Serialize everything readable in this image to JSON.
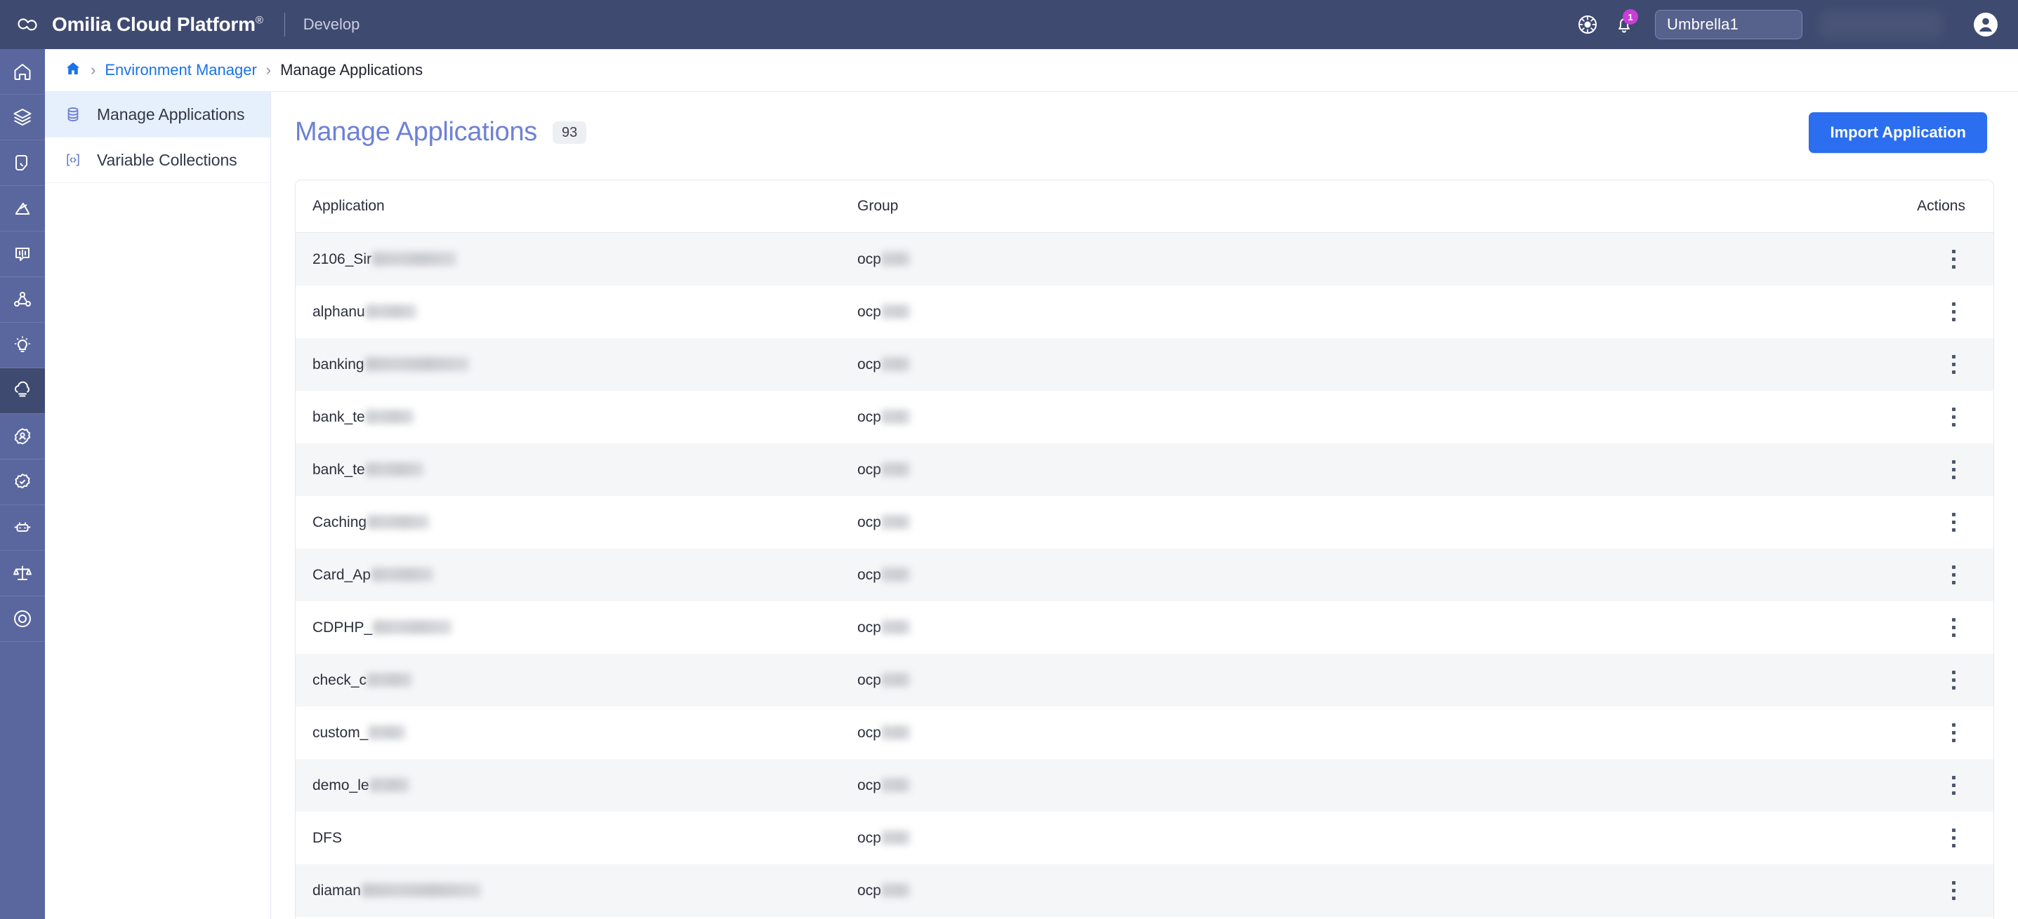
{
  "topbar": {
    "brand_name": "Omilia Cloud Platform",
    "brand_trademark": "®",
    "environment_label": "Develop",
    "logo_icon": "omilia-cloud-logo",
    "theme_icon": "theme-wheel-icon",
    "notifications_icon": "bell-icon",
    "notifications_count": "1",
    "tenant_name": "Umbrella1",
    "avatar_icon": "user-avatar-icon",
    "accent_color": "#2b6ef0",
    "bar_color": "#3f4a70",
    "badge_color": "#c83ed6"
  },
  "rail": {
    "items": [
      {
        "name": "home",
        "icon": "home-icon",
        "active": false
      },
      {
        "name": "applications",
        "icon": "layers-icon",
        "active": false
      },
      {
        "name": "tagging",
        "icon": "tag-hand-icon",
        "active": false
      },
      {
        "name": "analytics",
        "icon": "analytics-icon",
        "active": false
      },
      {
        "name": "conversations",
        "icon": "speech-waveform-icon",
        "active": false
      },
      {
        "name": "flows",
        "icon": "network-nodes-icon",
        "active": false
      },
      {
        "name": "insights",
        "icon": "lightbulb-icon",
        "active": false
      },
      {
        "name": "environment-manager",
        "icon": "cloud-icon",
        "active": true
      },
      {
        "name": "user-management",
        "icon": "gear-user-icon",
        "active": false
      },
      {
        "name": "quality-assurance",
        "icon": "badge-check-icon",
        "active": false
      },
      {
        "name": "automation",
        "icon": "robot-icon",
        "active": false
      },
      {
        "name": "compliance",
        "icon": "scales-icon",
        "active": false
      },
      {
        "name": "support",
        "icon": "lifebuoy-icon",
        "active": false
      }
    ]
  },
  "breadcrumb": {
    "home_icon": "home-icon",
    "separator": "›",
    "items": [
      {
        "label": "Environment Manager",
        "current": false
      },
      {
        "label": "Manage Applications",
        "current": true
      }
    ]
  },
  "sidebar": {
    "items": [
      {
        "label": "Manage Applications",
        "icon": "database-icon",
        "active": true
      },
      {
        "label": "Variable Collections",
        "icon": "code-brackets-icon",
        "active": false
      }
    ]
  },
  "page": {
    "title": "Manage Applications",
    "count": "93",
    "import_button": "Import Application"
  },
  "table": {
    "columns": [
      "Application",
      "Group",
      "Actions"
    ],
    "row_action_icon": "more-vertical-icon",
    "rows": [
      {
        "application": "2106_Sir",
        "application_redacted_width": 120,
        "group": "ocp",
        "group_redacted_width": 40
      },
      {
        "application": "alphanu",
        "application_redacted_width": 72,
        "group": "ocp",
        "group_redacted_width": 40
      },
      {
        "application": "banking",
        "application_redacted_width": 148,
        "group": "ocp",
        "group_redacted_width": 40
      },
      {
        "application": "bank_te",
        "application_redacted_width": 68,
        "group": "ocp",
        "group_redacted_width": 40
      },
      {
        "application": "bank_te",
        "application_redacted_width": 82,
        "group": "ocp",
        "group_redacted_width": 40
      },
      {
        "application": "Caching",
        "application_redacted_width": 88,
        "group": "ocp",
        "group_redacted_width": 40
      },
      {
        "application": "Card_Ap",
        "application_redacted_width": 88,
        "group": "ocp",
        "group_redacted_width": 40
      },
      {
        "application": "CDPHP_",
        "application_redacted_width": 112,
        "group": "ocp",
        "group_redacted_width": 40
      },
      {
        "application": "check_c",
        "application_redacted_width": 64,
        "group": "ocp",
        "group_redacted_width": 40
      },
      {
        "application": "custom_",
        "application_redacted_width": 52,
        "group": "ocp",
        "group_redacted_width": 40
      },
      {
        "application": "demo_le",
        "application_redacted_width": 56,
        "group": "ocp",
        "group_redacted_width": 40
      },
      {
        "application": "DFS",
        "application_redacted_width": 0,
        "group": "ocp",
        "group_redacted_width": 40
      },
      {
        "application": "diaman",
        "application_redacted_width": 170,
        "group": "ocp",
        "group_redacted_width": 40
      }
    ]
  }
}
